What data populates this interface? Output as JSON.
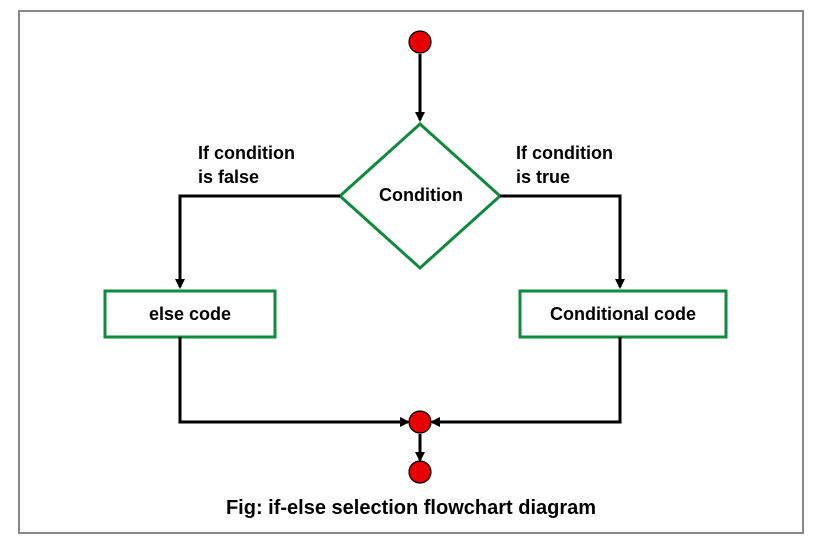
{
  "diagram": {
    "caption": "Fig: if-else selection flowchart diagram",
    "decision_label": "Condition",
    "false_branch_label_1": "If condition",
    "false_branch_label_2": "is false",
    "true_branch_label_1": "If condition",
    "true_branch_label_2": "is true",
    "false_box_label": "else code",
    "true_box_label": "Conditional code",
    "colors": {
      "stroke_green": "#0f8a3e",
      "start_end_red": "#e60000",
      "arrow_black": "#000000"
    }
  }
}
